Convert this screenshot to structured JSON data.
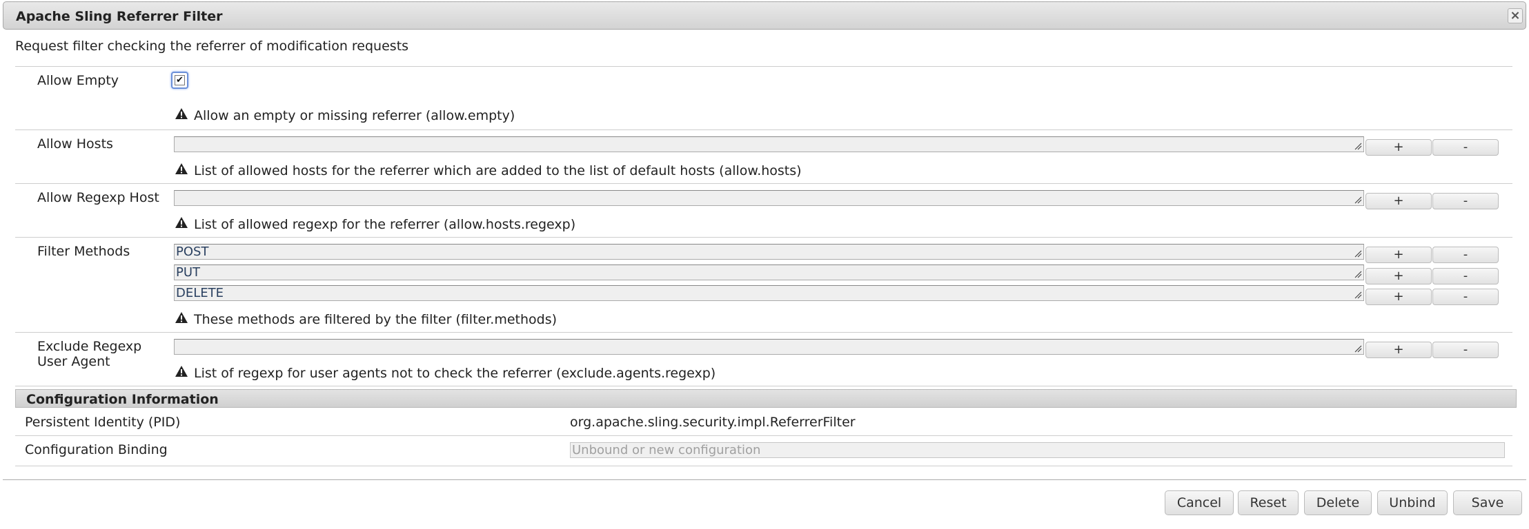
{
  "dialog": {
    "title": "Apache Sling Referrer Filter",
    "description": "Request filter checking the referrer of modification requests"
  },
  "properties": {
    "allow_empty": {
      "label": "Allow Empty",
      "checked": true,
      "hint": "Allow an empty or missing referrer (allow.empty)"
    },
    "allow_hosts": {
      "label": "Allow Hosts",
      "values": [
        ""
      ],
      "hint": "List of allowed hosts for the referrer which are added to the list of default hosts (allow.hosts)"
    },
    "allow_regexp_host": {
      "label": "Allow Regexp Host",
      "values": [
        ""
      ],
      "hint": "List of allowed regexp for the referrer (allow.hosts.regexp)"
    },
    "filter_methods": {
      "label": "Filter Methods",
      "values": [
        "POST",
        "PUT",
        "DELETE"
      ],
      "hint": "These methods are filtered by the filter (filter.methods)"
    },
    "exclude_agents": {
      "label_line1": "Exclude Regexp",
      "label_line2": "User Agent",
      "values": [
        ""
      ],
      "hint": "List of regexp for user agents not to check the referrer (exclude.agents.regexp)"
    }
  },
  "multivalue_buttons": {
    "add": "+",
    "remove": "-"
  },
  "config_info": {
    "header": "Configuration Information",
    "pid_label": "Persistent Identity (PID)",
    "pid_value": "org.apache.sling.security.impl.ReferrerFilter",
    "binding_label": "Configuration Binding",
    "binding_placeholder": "Unbound or new configuration"
  },
  "footer": {
    "cancel": "Cancel",
    "reset": "Reset",
    "delete": "Delete",
    "unbind": "Unbind",
    "save": "Save"
  },
  "icons": {
    "close": "close-icon",
    "warning": "warning-icon",
    "resize_grip": "resize-grip-icon"
  }
}
